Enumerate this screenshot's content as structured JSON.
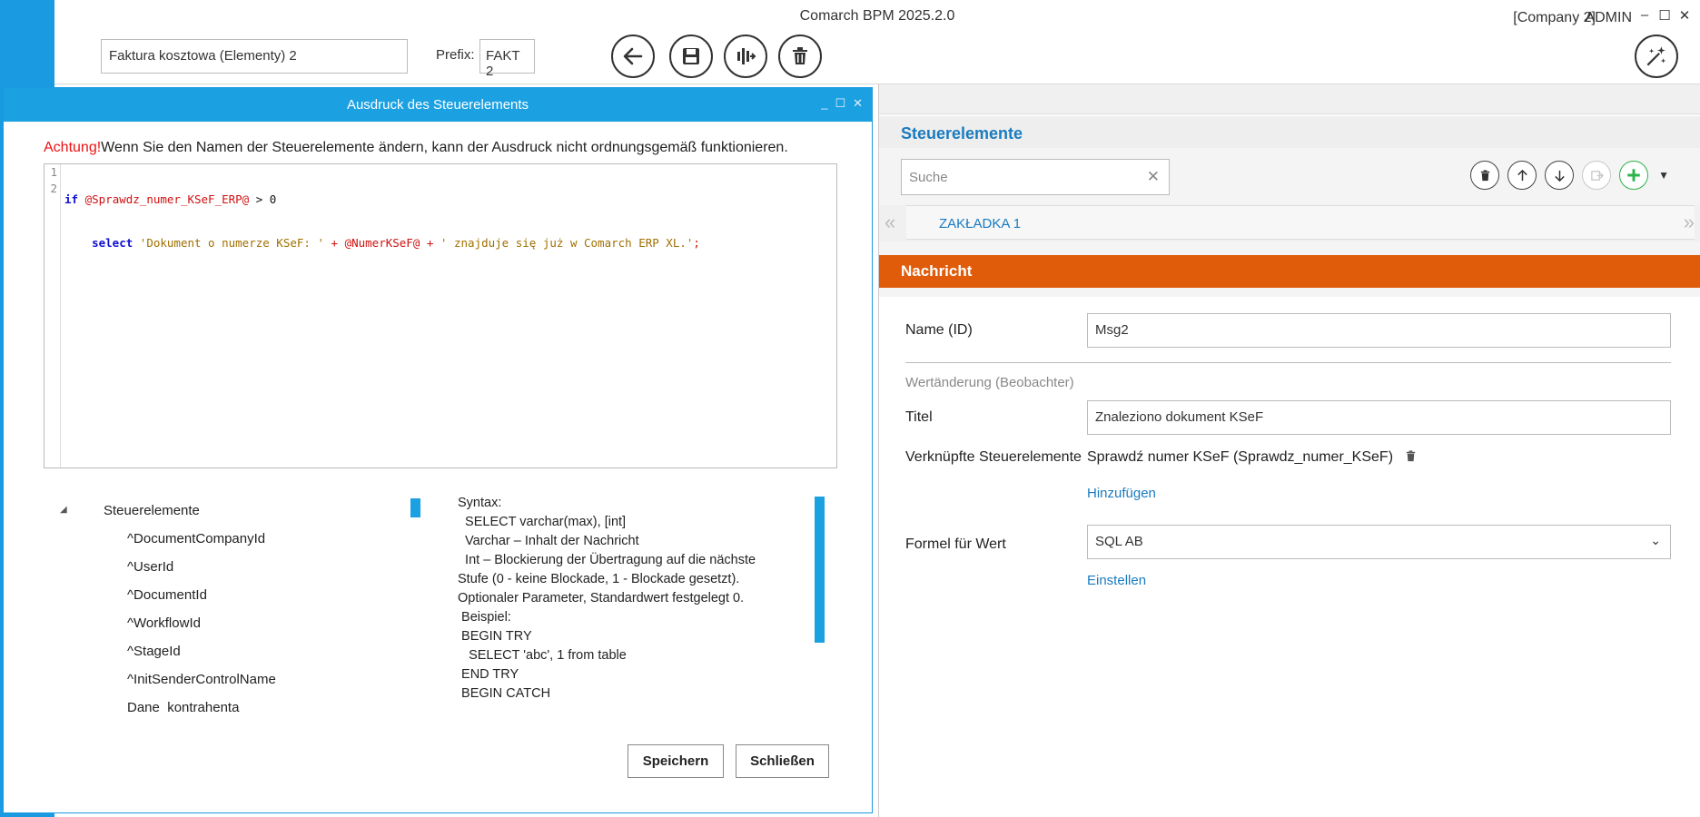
{
  "app": {
    "title": "Comarch BPM 2025.2.0",
    "company": "[Company 2]",
    "user": "ADMIN",
    "win_min": "–",
    "win_max": "☐",
    "win_close": "✕"
  },
  "header": {
    "document_name": "Faktura kosztowa (Elementy) 2",
    "prefix_label": "Prefix:",
    "prefix_value": "FAKT 2",
    "icons": [
      "back-arrow-icon",
      "save-icon",
      "process-icon",
      "trash-icon",
      "magic-wand-icon"
    ]
  },
  "dialog": {
    "title": "Ausdruck des Steuerelements",
    "win_min": "_",
    "win_max": "☐",
    "win_close": "✕",
    "warning_prefix": "Achtung!",
    "warning_text": "Wenn Sie den Namen der Steuerelemente ändern, kann der Ausdruck nicht ordnungsgemäß funktionieren.",
    "code": {
      "line_numbers": [
        "1",
        "2"
      ],
      "line1": {
        "kw_if": "if",
        "var1": "@Sprawdz_numer_KSeF_ERP@",
        "op1": " > ",
        "num1": "0"
      },
      "line2": {
        "indent": "    ",
        "kw_select": "select",
        "str1": "'Dokument o numerze KSeF: '",
        "op1": " + ",
        "var1": "@NumerKSeF@",
        "op2": " + ",
        "str2": "' znajduje się już w Comarch ERP XL.'",
        "end": ";"
      }
    },
    "tree": {
      "root": "Steuerelemente",
      "items": [
        "^DocumentCompanyId",
        "^UserId",
        "^DocumentId",
        "^WorkflowId",
        "^StageId",
        "^InitSenderControlName",
        "Dane_kontrahenta"
      ]
    },
    "syntax_lines": [
      "Syntax:",
      "  SELECT varchar(max), [int]",
      "  Varchar – Inhalt der Nachricht",
      "  Int – Blockierung der Übertragung auf die nächste",
      "Stufe (0 - keine Blockade, 1 - Blockade gesetzt).",
      "Optionaler Parameter, Standardwert festgelegt 0.",
      " Beispiel:",
      " BEGIN TRY",
      "   SELECT 'abc', 1 from table",
      " END TRY",
      " BEGIN CATCH"
    ],
    "save_button": "Speichern",
    "close_button": "Schließen"
  },
  "right_panel": {
    "heading": "Steuerelemente",
    "search_placeholder": "Suche",
    "search_clear": "✕",
    "tab_label": "ZAKŁADKA 1",
    "nav_left": "«",
    "nav_right": "»",
    "section_title": "Nachricht",
    "name_label": "Name (ID)",
    "name_value": "Msg2",
    "observer_heading": "Wertänderung (Beobachter)",
    "title_label": "Titel",
    "title_value": "Znaleziono dokument KSeF",
    "linked_label": "Verknüpfte Steuerelemente",
    "linked_value": "Sprawdź numer KSeF (Sprawdz_numer_KSeF)",
    "add_link": "Hinzufügen",
    "formula_label": "Formel für Wert",
    "formula_value": "SQL AB",
    "configure_link": "Einstellen",
    "toolbar_icons": [
      "trash-icon",
      "arrow-up-icon",
      "arrow-down-icon",
      "export-icon",
      "add-icon",
      "dropdown-icon"
    ]
  },
  "colors": {
    "accent_blue": "#1ba0e2",
    "link_blue": "#1a7bc0",
    "orange": "#e05c0a",
    "add_green": "#2bb44a",
    "warning_red": "#e11111"
  }
}
